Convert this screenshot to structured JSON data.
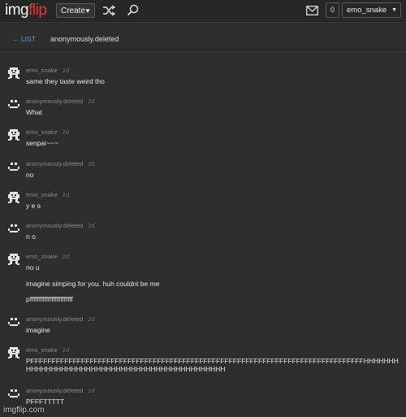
{
  "app": {
    "logo_part1": "img",
    "logo_part2": "flip",
    "create_label": "Create",
    "notification_count": "0",
    "username": "emo_snake"
  },
  "conversation": {
    "back_label": "← LIST",
    "title": "anonymously.deleted"
  },
  "messages": [
    {
      "author": "emo_snake",
      "time": "2d",
      "lines": [
        "same they taste weird tho"
      ],
      "avatar": "pixel-creature-icon"
    },
    {
      "author": "anonymously.deleted",
      "time": "2d",
      "lines": [
        "What"
      ],
      "avatar": "smiley-icon"
    },
    {
      "author": "emo_snake",
      "time": "2d",
      "lines": [
        "senpai~~~"
      ],
      "avatar": "pixel-creature-icon"
    },
    {
      "author": "anonymously.deleted",
      "time": "2d",
      "lines": [
        "no"
      ],
      "avatar": "smiley-icon"
    },
    {
      "author": "emo_snake",
      "time": "2d",
      "lines": [
        "y e s"
      ],
      "avatar": "pixel-creature-icon"
    },
    {
      "author": "anonymously.deleted",
      "time": "2d",
      "lines": [
        "n o"
      ],
      "avatar": "smiley-icon"
    },
    {
      "author": "emo_snake",
      "time": "2d",
      "lines": [
        "no u",
        "imagine simping for you. huh couldnt be me",
        "pffffffffffffffffffffffff"
      ],
      "avatar": "pixel-creature-icon"
    },
    {
      "author": "anonymously.deleted",
      "time": "2d",
      "lines": [
        "imagine"
      ],
      "avatar": "smiley-icon"
    },
    {
      "author": "emo_snake",
      "time": "2d",
      "lines": [
        "PFFFFFFFFFFFFFFFFFFFFFFFFFFFFFFFFFFFFFFFFFFFFFFFFFFFFFFFFFFFFFFFFFFFFFFFFFFFFFFFHHHHHHHHHHHHHHHHHHHHHHHHHHHHHHHHHHHHHHHHHHHHHHH"
      ],
      "avatar": "pixel-creature-icon"
    },
    {
      "author": "anonymously.deleted",
      "time": "2d",
      "lines": [
        "PFFFTTTTT"
      ],
      "avatar": "smiley-icon"
    }
  ],
  "watermark": "imgflip.com"
}
